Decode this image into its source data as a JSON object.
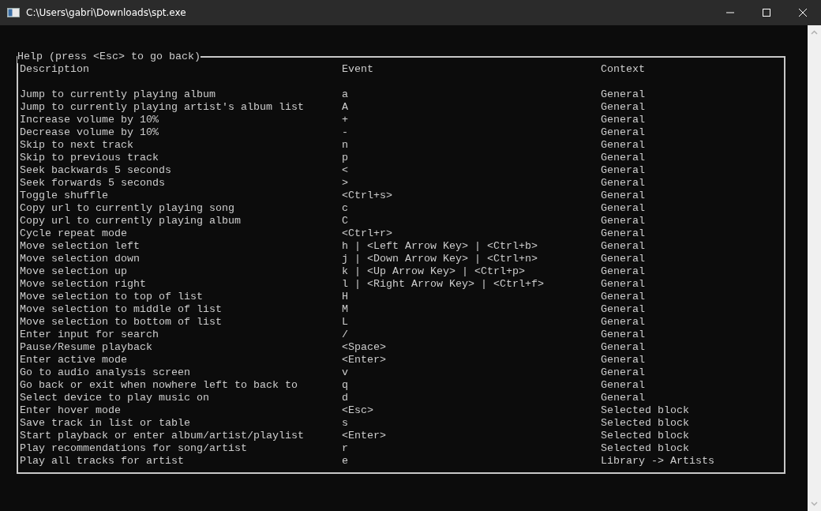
{
  "window": {
    "title": "C:\\Users\\gabri\\Downloads\\spt.exe"
  },
  "help": {
    "title": "Help (press <Esc> to go back)",
    "columns": [
      "Description",
      "Event",
      "Context"
    ],
    "rows": [
      {
        "description": "Jump to currently playing album",
        "event": "a",
        "context": "General"
      },
      {
        "description": "Jump to currently playing artist's album list",
        "event": "A",
        "context": "General"
      },
      {
        "description": "Increase volume by 10%",
        "event": "+",
        "context": "General"
      },
      {
        "description": "Decrease volume by 10%",
        "event": "-",
        "context": "General"
      },
      {
        "description": "Skip to next track",
        "event": "n",
        "context": "General"
      },
      {
        "description": "Skip to previous track",
        "event": "p",
        "context": "General"
      },
      {
        "description": "Seek backwards 5 seconds",
        "event": "<",
        "context": "General"
      },
      {
        "description": "Seek forwards 5 seconds",
        "event": ">",
        "context": "General"
      },
      {
        "description": "Toggle shuffle",
        "event": "<Ctrl+s>",
        "context": "General"
      },
      {
        "description": "Copy url to currently playing song",
        "event": "c",
        "context": "General"
      },
      {
        "description": "Copy url to currently playing album",
        "event": "C",
        "context": "General"
      },
      {
        "description": "Cycle repeat mode",
        "event": "<Ctrl+r>",
        "context": "General"
      },
      {
        "description": "Move selection left",
        "event": "h | <Left Arrow Key> | <Ctrl+b>",
        "context": "General"
      },
      {
        "description": "Move selection down",
        "event": "j | <Down Arrow Key> | <Ctrl+n>",
        "context": "General"
      },
      {
        "description": "Move selection up",
        "event": "k | <Up Arrow Key> | <Ctrl+p>",
        "context": "General"
      },
      {
        "description": "Move selection right",
        "event": "l | <Right Arrow Key> | <Ctrl+f>",
        "context": "General"
      },
      {
        "description": "Move selection to top of list",
        "event": "H",
        "context": "General"
      },
      {
        "description": "Move selection to middle of list",
        "event": "M",
        "context": "General"
      },
      {
        "description": "Move selection to bottom of list",
        "event": "L",
        "context": "General"
      },
      {
        "description": "Enter input for search",
        "event": "/",
        "context": "General"
      },
      {
        "description": "Pause/Resume playback",
        "event": "<Space>",
        "context": "General"
      },
      {
        "description": "Enter active mode",
        "event": "<Enter>",
        "context": "General"
      },
      {
        "description": "Go to audio analysis screen",
        "event": "v",
        "context": "General"
      },
      {
        "description": "Go back or exit when nowhere left to back to",
        "event": "q",
        "context": "General"
      },
      {
        "description": "Select device to play music on",
        "event": "d",
        "context": "General"
      },
      {
        "description": "Enter hover mode",
        "event": "<Esc>",
        "context": "Selected block"
      },
      {
        "description": "Save track in list or table",
        "event": "s",
        "context": "Selected block"
      },
      {
        "description": "Start playback or enter album/artist/playlist",
        "event": "<Enter>",
        "context": "Selected block"
      },
      {
        "description": "Play recommendations for song/artist",
        "event": "r",
        "context": "Selected block"
      },
      {
        "description": "Play all tracks for artist",
        "event": "e",
        "context": "Library -> Artists"
      }
    ]
  }
}
